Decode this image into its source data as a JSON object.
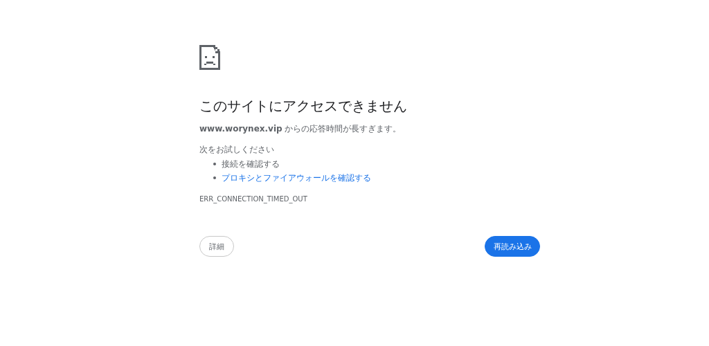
{
  "error_page": {
    "title": "このサイトにアクセスできません",
    "message": "**www.worynex.vip** からの応答時間が長すぎます。",
    "suggestions_heading": "次をお試しください",
    "suggestions": [
      {
        "kind": "text",
        "label": "接続を確認する"
      },
      {
        "kind": "link",
        "label": "プロキシとファイアウォールを確認する"
      }
    ],
    "error_code": "ERR_CONNECTION_TIMED_OUT"
  },
  "buttons": [
    {
      "kind": "secondary",
      "label": "詳細"
    },
    {
      "kind": "primary",
      "label": "再読み込み"
    }
  ]
}
